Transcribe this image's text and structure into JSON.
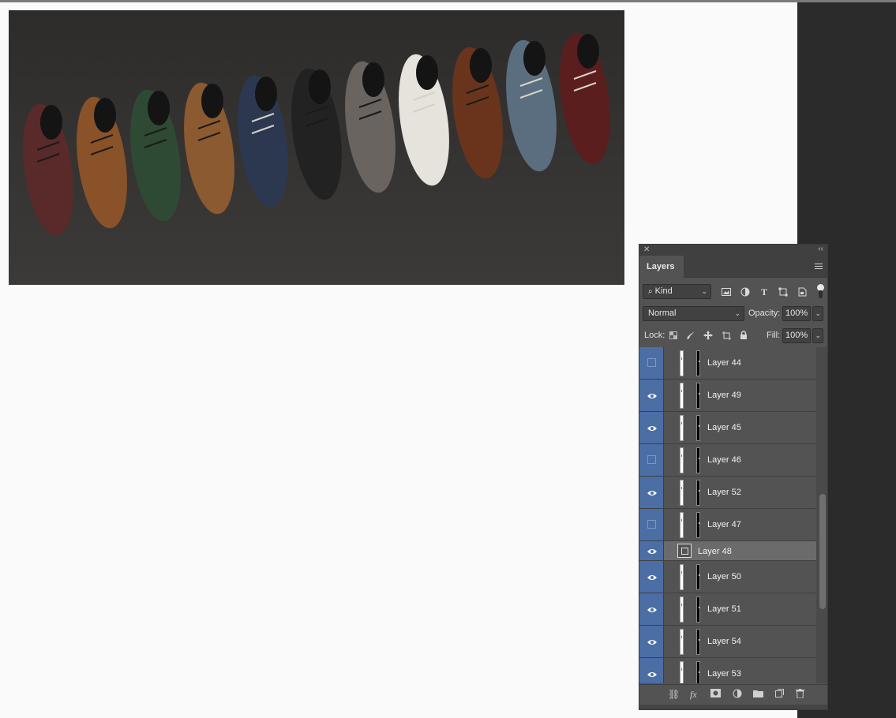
{
  "panel": {
    "tab_label": "Layers",
    "close_glyph": "✕",
    "collapse_glyph": "‹‹",
    "filter": {
      "kind_label": "Kind"
    },
    "blend_mode": "Normal",
    "opacity_label": "Opacity:",
    "opacity_value": "100%",
    "lock_label": "Lock:",
    "fill_label": "Fill:",
    "fill_value": "100%",
    "footer_icons": [
      "link-icon",
      "fx-icon",
      "mask-icon",
      "adjustment-icon",
      "folder-icon",
      "new-layer-icon",
      "trash-icon"
    ]
  },
  "layers": [
    {
      "name": "Layer 44",
      "visible": false,
      "selected": false
    },
    {
      "name": "Layer 49",
      "visible": true,
      "selected": false
    },
    {
      "name": "Layer 45",
      "visible": true,
      "selected": false
    },
    {
      "name": "Layer 46",
      "visible": false,
      "selected": false
    },
    {
      "name": "Layer 52",
      "visible": true,
      "selected": false
    },
    {
      "name": "Layer 47",
      "visible": false,
      "selected": false
    },
    {
      "name": "Layer 48",
      "visible": true,
      "selected": true,
      "smart_object": true
    },
    {
      "name": "Layer 50",
      "visible": true,
      "selected": false
    },
    {
      "name": "Layer 51",
      "visible": true,
      "selected": false
    },
    {
      "name": "Layer 54",
      "visible": true,
      "selected": false
    },
    {
      "name": "Layer 53",
      "visible": true,
      "selected": false
    }
  ],
  "colors": {
    "eye_column": "#4b6ea5",
    "panel_bg": "#535353",
    "canvas_bg": "#fafafa"
  },
  "photo": {
    "shoe_colors": [
      "#5a2a2a",
      "#8a5228",
      "#2f4a34",
      "#8c5a30",
      "#2c3850",
      "#222222",
      "#6a6460",
      "#e6e2dc",
      "#6a341c",
      "#5a6e80",
      "#5a1e1e"
    ]
  }
}
